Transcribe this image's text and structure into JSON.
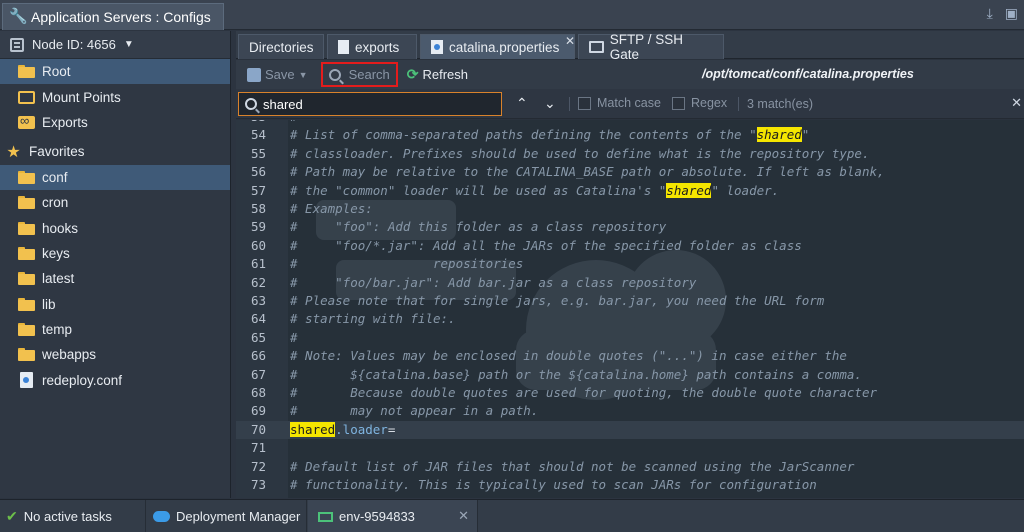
{
  "titlebar": {
    "title": "Application Servers : Configs"
  },
  "sidebar": {
    "node_label": "Node ID: 4656",
    "items": [
      {
        "label": "Root",
        "icon": "folder-icon",
        "selected": true
      },
      {
        "label": "Mount Points",
        "icon": "mount-icon"
      },
      {
        "label": "Exports",
        "icon": "exports-icon"
      }
    ],
    "favorites_label": "Favorites",
    "favorites": [
      {
        "label": "conf",
        "icon": "folder-icon",
        "selected": true
      },
      {
        "label": "cron",
        "icon": "folder-icon"
      },
      {
        "label": "hooks",
        "icon": "folder-icon"
      },
      {
        "label": "keys",
        "icon": "folder-icon"
      },
      {
        "label": "latest",
        "icon": "folder-icon"
      },
      {
        "label": "lib",
        "icon": "folder-icon"
      },
      {
        "label": "temp",
        "icon": "folder-icon"
      },
      {
        "label": "webapps",
        "icon": "folder-icon"
      },
      {
        "label": "redeploy.conf",
        "icon": "file-icon"
      }
    ]
  },
  "tabs": [
    {
      "label": "Directories"
    },
    {
      "label": "exports"
    },
    {
      "label": "catalina.properties",
      "active": true
    },
    {
      "label": "SFTP / SSH Gate"
    }
  ],
  "toolbar": {
    "save_label": "Save",
    "search_label": "Search",
    "refresh_label": "Refresh",
    "path": "/opt/tomcat/conf/catalina.properties"
  },
  "find": {
    "query": "shared",
    "match_case_label": "Match case",
    "regex_label": "Regex",
    "matches_label": "3 match(es)"
  },
  "editor": {
    "first_partial_line": "#",
    "lines": [
      {
        "n": "54",
        "pre": "# List of comma-separated paths defining the contents of the \"",
        "hl": "shared",
        "post": "\""
      },
      {
        "n": "55",
        "pre": "# classloader. Prefixes should be used to define what is the repository type."
      },
      {
        "n": "56",
        "pre": "# Path may be relative to the CATALINA_BASE path or absolute. If left as blank,"
      },
      {
        "n": "57",
        "pre": "# the \"common\" loader will be used as Catalina's \"",
        "hl": "shared",
        "post": "\" loader."
      },
      {
        "n": "58",
        "pre": "# Examples:"
      },
      {
        "n": "59",
        "pre": "#     \"foo\": Add this folder as a class repository"
      },
      {
        "n": "60",
        "pre": "#     \"foo/*.jar\": Add all the JARs of the specified folder as class"
      },
      {
        "n": "61",
        "pre": "#                  repositories"
      },
      {
        "n": "62",
        "pre": "#     \"foo/bar.jar\": Add bar.jar as a class repository"
      },
      {
        "n": "63",
        "pre": "# Please note that for single jars, e.g. bar.jar, you need the URL form"
      },
      {
        "n": "64",
        "pre": "# starting with file:."
      },
      {
        "n": "65",
        "pre": "#"
      },
      {
        "n": "66",
        "pre": "# Note: Values may be enclosed in double quotes (\"...\") in case either the"
      },
      {
        "n": "67",
        "pre": "#       ${catalina.base} path or the ${catalina.home} path contains a comma."
      },
      {
        "n": "68",
        "pre": "#       Because double quotes are used for quoting, the double quote character"
      },
      {
        "n": "69",
        "pre": "#       may not appear in a path."
      },
      {
        "n": "70",
        "kv": true,
        "hl": "shared",
        "post": ".loader",
        "eq": "="
      },
      {
        "n": "71",
        "pre": ""
      },
      {
        "n": "72",
        "pre": "# Default list of JAR files that should not be scanned using the JarScanner"
      },
      {
        "n": "73",
        "pre": "# functionality. This is typically used to scan JARs for configuration"
      }
    ]
  },
  "bottom": {
    "tasks_label": "No active tasks",
    "deploy_label": "Deployment Manager",
    "env_label": "env-9594833"
  }
}
